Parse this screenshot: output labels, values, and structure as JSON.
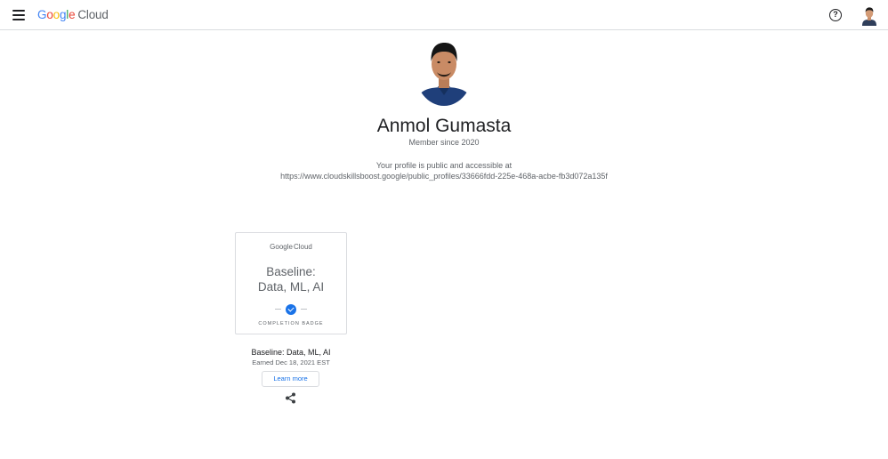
{
  "header": {
    "logo_word": [
      "G",
      "o",
      "o",
      "g",
      "l",
      "e"
    ],
    "logo_colors": [
      "#4285f4",
      "#ea4335",
      "#fbbc05",
      "#4285f4",
      "#34a853",
      "#ea4335"
    ],
    "logo_product": "Cloud",
    "menu_icon": "hamburger-menu-icon",
    "help_icon": "help-circle-icon",
    "help_glyph": "?"
  },
  "profile": {
    "name": "Anmol Gumasta",
    "member_since": "Member since 2020",
    "public_notice": "Your profile is public and accessible at",
    "public_url": "https://www.cloudskillsboost.google/public_profiles/33666fdd-225e-468a-acbe-fb3d072a135f"
  },
  "badge": {
    "card_logo_word": "Google",
    "card_logo_product": "Cloud",
    "card_title_line1": "Baseline:",
    "card_title_line2": "Data, ML, AI",
    "card_type": "COMPLETION BADGE",
    "name": "Baseline: Data, ML, AI",
    "earned": "Earned Dec 18, 2021 EST",
    "learn_more_label": "Learn more",
    "check_color": "#1a73e8",
    "share_icon": "share-icon"
  }
}
